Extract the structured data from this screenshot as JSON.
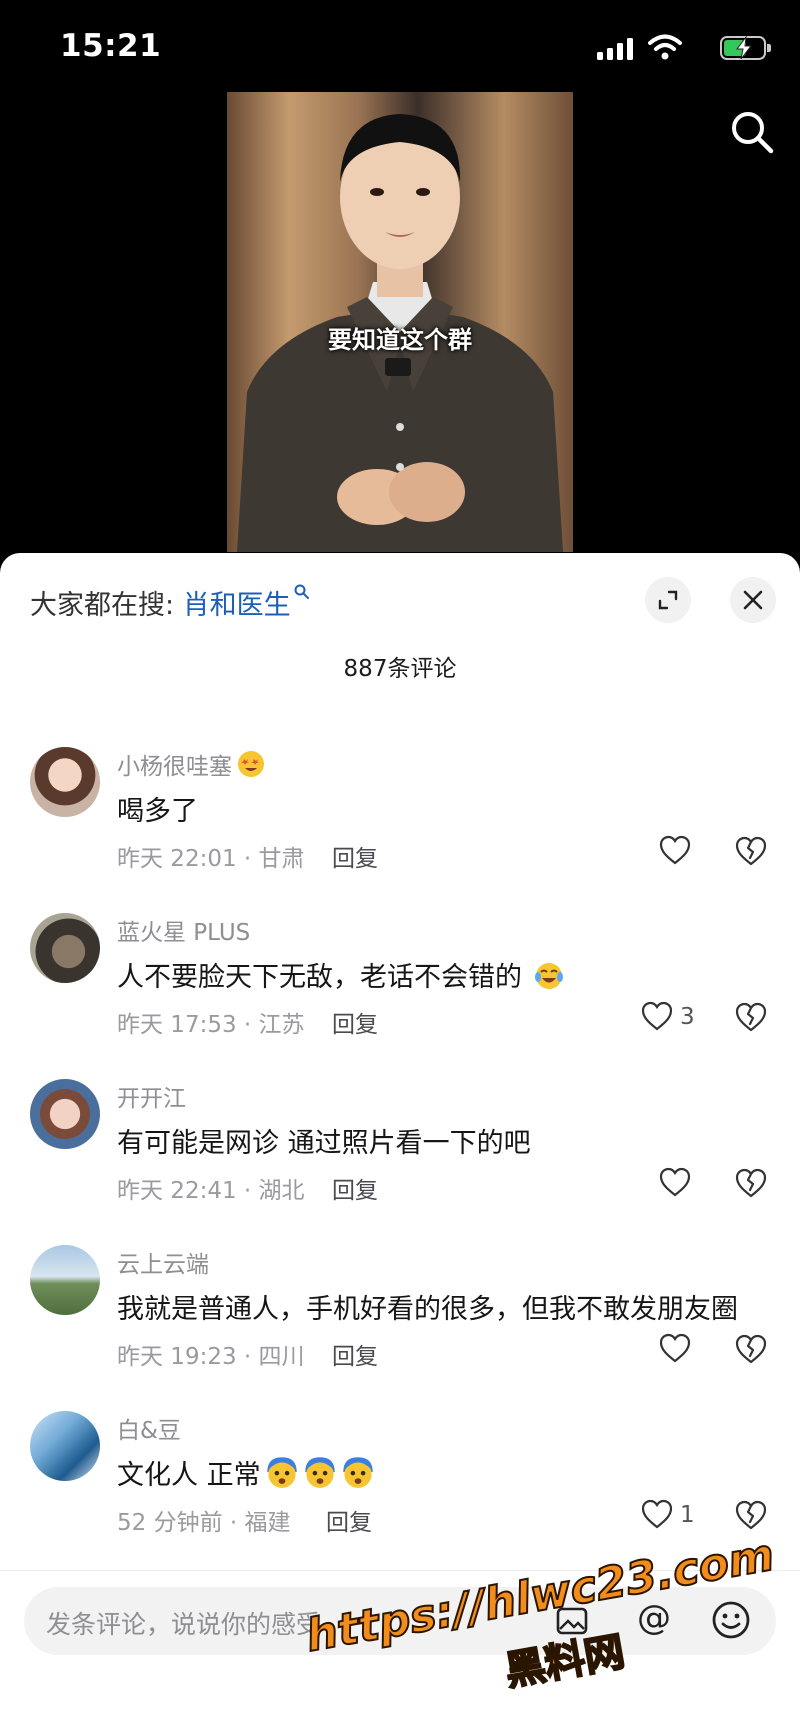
{
  "status_bar": {
    "time": "15:21"
  },
  "video": {
    "caption": "要知道这个群"
  },
  "sheet": {
    "hot_search_prefix": "大家都在搜: ",
    "hot_search_keyword": "肖和医生",
    "comment_count": "887条评论"
  },
  "comments": [
    {
      "user": "小杨很哇塞",
      "text": "喝多了",
      "time_location": "昨天 22:01 · 甘肃",
      "reply": "回复",
      "likes": ""
    },
    {
      "user": "蓝火星 PLUS",
      "text": "人不要脸天下无敌，老话不会错的",
      "time_location": "昨天 17:53 · 江苏",
      "reply": "回复",
      "likes": "3"
    },
    {
      "user": "开开江",
      "text": "有可能是网诊 通过照片看一下的吧",
      "time_location": "昨天 22:41 · 湖北",
      "reply": "回复",
      "likes": ""
    },
    {
      "user": "云上云端",
      "text": "我就是普通人，手机好看的很多，但我不敢发朋友圈",
      "time_location": "昨天 19:23 · 四川",
      "reply": "回复",
      "likes": ""
    },
    {
      "user": "白&豆",
      "text": "文化人 正常",
      "time_location": "52 分钟前 · 福建",
      "reply": "回复",
      "likes": "1"
    }
  ],
  "input": {
    "placeholder": "发条评论，说说你的感受",
    "at_symbol": "@"
  },
  "watermark": {
    "url": "https://hlwc23.com",
    "name": "黑料网"
  },
  "colors": {
    "accent_link": "#1d5fb8",
    "watermark": "#f28c1b"
  }
}
